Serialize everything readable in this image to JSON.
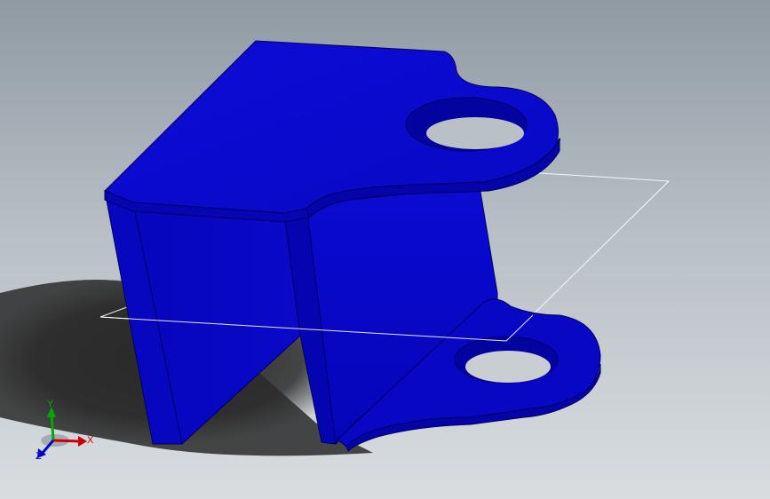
{
  "viewport": {
    "background_top": "#8f9aa3",
    "background_bottom": "#d9dde0"
  },
  "part": {
    "color": "#0a0acf",
    "edge_color": "#000066"
  },
  "triad": {
    "x_label": "X",
    "y_label": "Y",
    "z_label": "Z",
    "x_color": "#cc0000",
    "y_color": "#00aa00",
    "z_color": "#0000cc"
  },
  "reference_plane": {
    "color": "#ffffff"
  }
}
